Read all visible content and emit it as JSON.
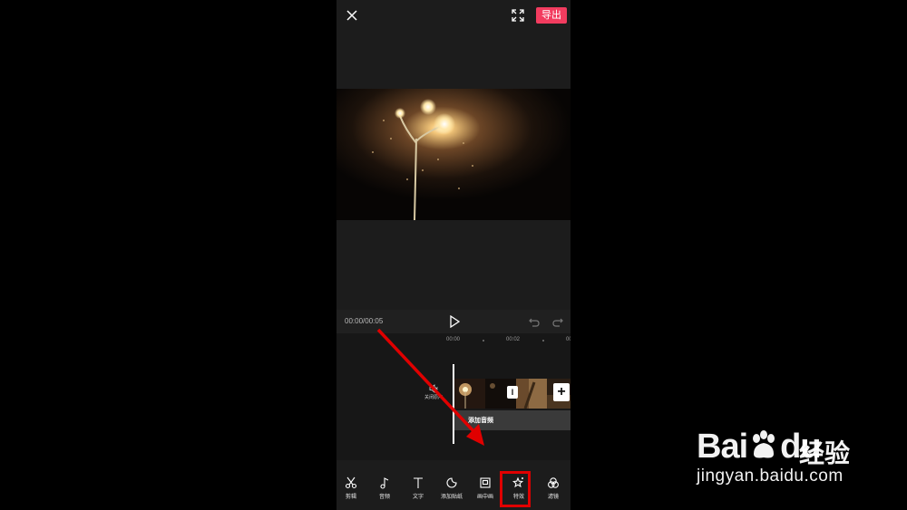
{
  "topbar": {
    "export_label": "导出"
  },
  "player": {
    "time": "00:00/00:05"
  },
  "timeline": {
    "ruler": [
      "00:00",
      "00:02",
      "00"
    ],
    "mute_label": "关闭原声",
    "add_audio_label": "添加音频",
    "add_clip_label": "+",
    "transition_label": "I"
  },
  "toolbar": {
    "items": [
      {
        "label": "剪辑",
        "icon": "scissors-icon"
      },
      {
        "label": "音频",
        "icon": "music-note-icon"
      },
      {
        "label": "文字",
        "icon": "text-icon"
      },
      {
        "label": "添加贴纸",
        "icon": "sticker-icon"
      },
      {
        "label": "画中画",
        "icon": "picture-in-picture-icon"
      },
      {
        "label": "特效",
        "icon": "effects-star-icon"
      },
      {
        "label": "滤镜",
        "icon": "filter-icon"
      }
    ]
  },
  "watermark": {
    "logo": "Bai",
    "logo_tail": "du",
    "cn": "经验",
    "url": "jingyan.baidu.com"
  },
  "colors": {
    "accent": "#f23c5f",
    "highlight": "#e00000",
    "background": "#1c1c1c"
  }
}
